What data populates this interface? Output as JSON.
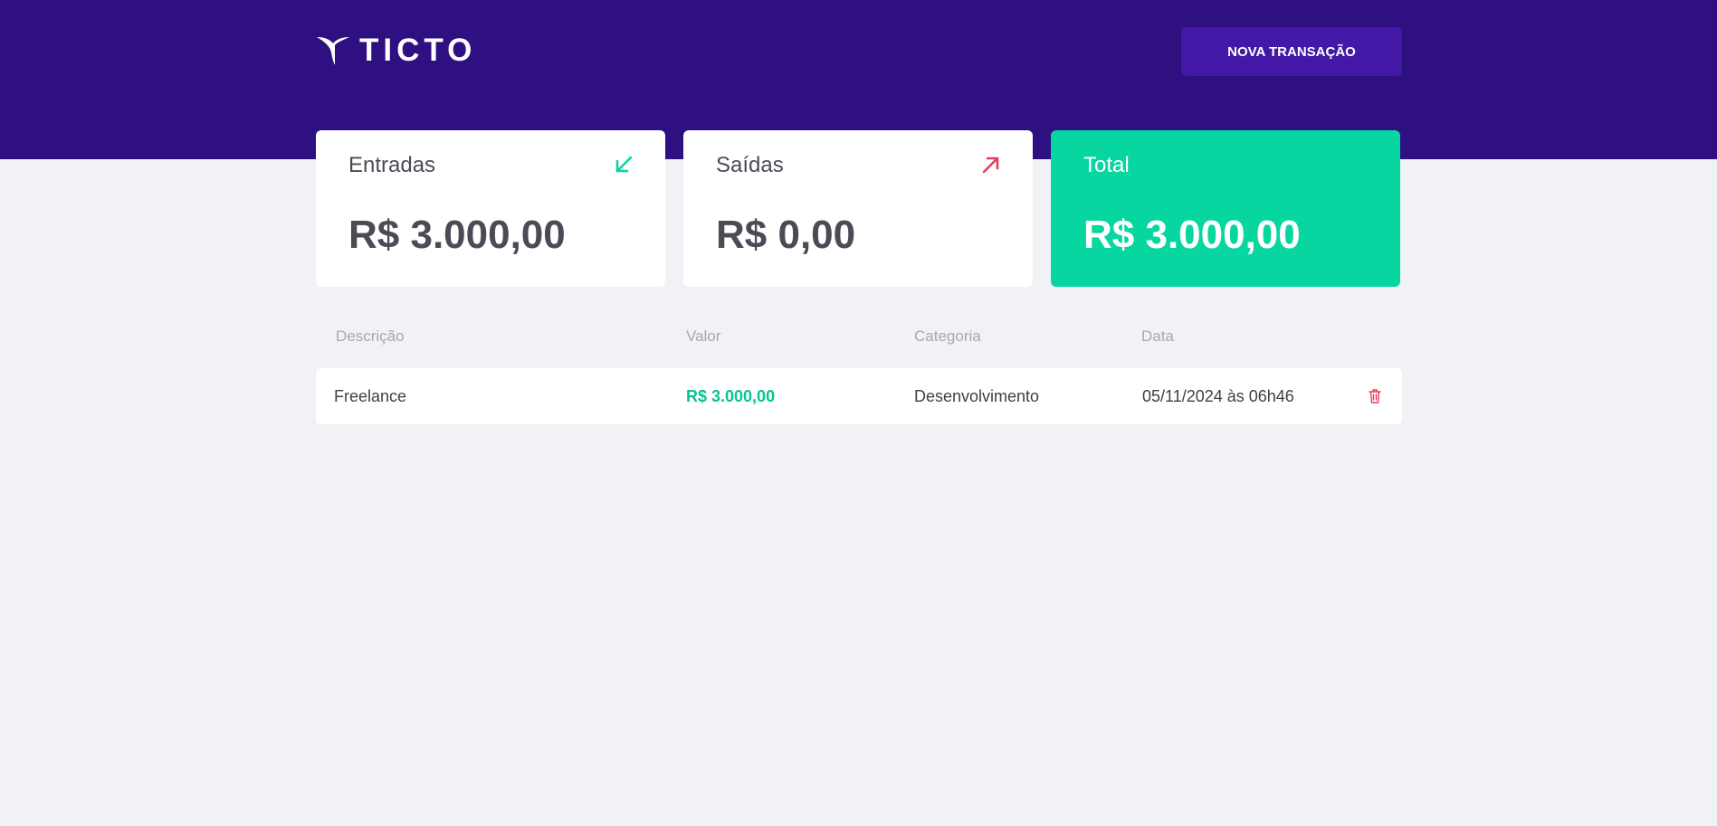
{
  "header": {
    "logo_text": "TICTO",
    "new_transaction_label": "NOVA TRANSAÇÃO"
  },
  "summary": {
    "income": {
      "label": "Entradas",
      "value": "R$ 3.000,00",
      "icon": "arrow-down-left-icon",
      "color": "#07d6a1"
    },
    "outcome": {
      "label": "Saídas",
      "value": "R$ 0,00",
      "icon": "arrow-up-right-icon",
      "color": "#e33d5f"
    },
    "total": {
      "label": "Total",
      "value": "R$ 3.000,00",
      "color": "#07d6a1"
    }
  },
  "table": {
    "columns": [
      "Descrição",
      "Valor",
      "Categoria",
      "Data"
    ],
    "rows": [
      {
        "description": "Freelance",
        "value": "R$ 3.000,00",
        "category": "Desenvolvimento",
        "date": "05/11/2024 às 06h46",
        "action_icon": "trash-icon"
      }
    ]
  },
  "colors": {
    "header_bg": "#2e1080",
    "button_bg": "#4318a6",
    "page_bg": "#f0f2f5",
    "positive": "#07c491",
    "negative": "#e33d5f"
  }
}
